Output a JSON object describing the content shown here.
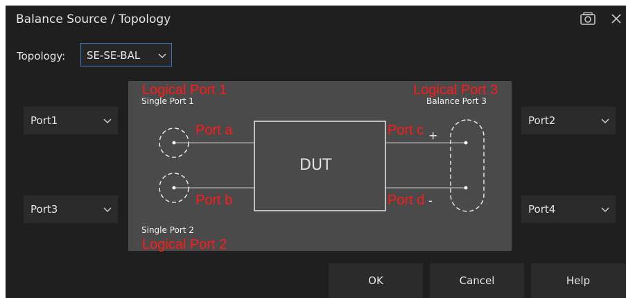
{
  "dialog": {
    "title": "Balance Source / Topology"
  },
  "topology": {
    "label": "Topology:",
    "value": "SE-SE-BAL"
  },
  "ports": {
    "top_left": "Port1",
    "bottom_left": "Port3",
    "top_right": "Port2",
    "bottom_right": "Port4"
  },
  "diagram": {
    "logical_port_1": "Logical Port 1",
    "logical_port_2": "Logical Port 2",
    "logical_port_3": "Logical Port 3",
    "single_port_1": "Single Port 1",
    "single_port_2": "Single Port 2",
    "balance_port_3": "Balance Port 3",
    "port_a": "Port a",
    "port_b": "Port b",
    "port_c": "Port c",
    "port_d": "Port d",
    "plus": "+",
    "minus": "-",
    "dut": "DUT"
  },
  "buttons": {
    "ok": "OK",
    "cancel": "Cancel",
    "help": "Help"
  }
}
